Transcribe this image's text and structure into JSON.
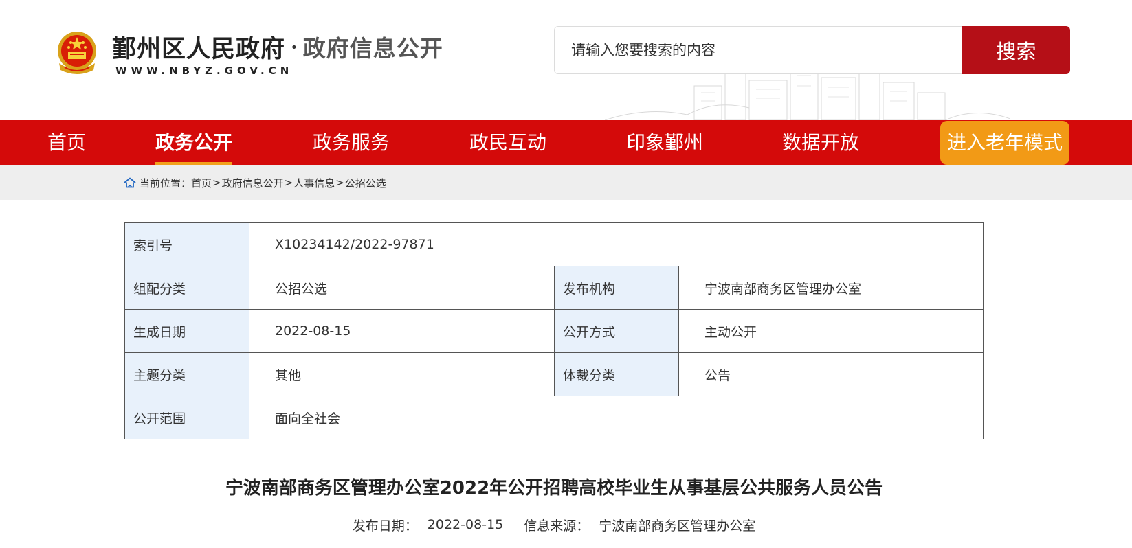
{
  "header": {
    "site_name": "鄞州区人民政府",
    "dot": "·",
    "section_name": "政府信息公开",
    "url": "WWW.NBYZ.GOV.CN",
    "search_placeholder": "请输入您要搜索的内容",
    "search_button": "搜索"
  },
  "nav": {
    "items": [
      {
        "label": "首页"
      },
      {
        "label": "政务公开"
      },
      {
        "label": "政务服务"
      },
      {
        "label": "政民互动"
      },
      {
        "label": "印象鄞州"
      },
      {
        "label": "数据开放"
      }
    ],
    "active_index": 1,
    "elder_mode": "进入老年模式"
  },
  "breadcrumb": {
    "prefix": "当前位置：",
    "items": [
      "首页",
      "政府信息公开",
      "人事信息",
      "公招公选"
    ],
    "sep": ">"
  },
  "meta": {
    "index_label": "索引号",
    "index_value": "X10234142/2022-97871",
    "group_label": "组配分类",
    "group_value": "公招公选",
    "publisher_label": "发布机构",
    "publisher_value": "宁波南部商务区管理办公室",
    "date_label": "生成日期",
    "date_value": "2022-08-15",
    "method_label": "公开方式",
    "method_value": "主动公开",
    "topic_label": "主题分类",
    "topic_value": "其他",
    "genre_label": "体裁分类",
    "genre_value": "公告",
    "scope_label": "公开范围",
    "scope_value": "面向全社会"
  },
  "article": {
    "title": "宁波南部商务区管理办公室2022年公开招聘高校毕业生从事基层公共服务人员公告",
    "date_label": "发布日期：",
    "date_value": "2022-08-15",
    "source_label": "信息来源：",
    "source_value": "宁波南部商务区管理办公室"
  },
  "colors": {
    "nav_red": "#d40a0a",
    "search_red": "#b50f17",
    "elder_orange": "#f29a16",
    "label_bg": "#e8f1fb"
  }
}
